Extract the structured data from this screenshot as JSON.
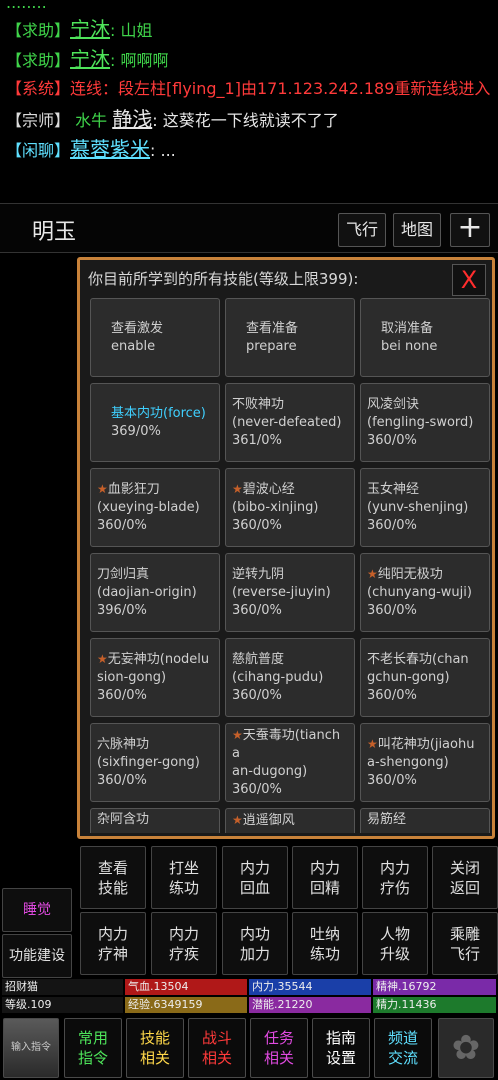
{
  "chat": {
    "partial": "........",
    "lines": [
      {
        "tag": "【求助】",
        "name": "宁沐",
        "msg": ": 山姐"
      },
      {
        "tag": "【求助】",
        "name": "宁沐",
        "msg": ": 啊啊啊"
      },
      {
        "tag": "【系统】",
        "text": "连线：段左柱[flying_1]由171.123.242.189重新连线进入"
      },
      {
        "tag": "【宗师】",
        "prefix": "水牛",
        "name": "静浅",
        "msg": ": 这葵花一下线就读不了了"
      },
      {
        "tag": "【闲聊】",
        "name": "慕蓉紫米",
        "msg": ": ..."
      }
    ]
  },
  "location": {
    "name": "明玉",
    "fly": "飞行",
    "map": "地图",
    "plus": "+"
  },
  "dialog": {
    "title": "你目前所学到的所有技能(等级上限399):",
    "close": "X",
    "skills": [
      {
        "l1": "查看激发",
        "l2": "enable",
        "l3": ""
      },
      {
        "l1": "查看准备",
        "l2": "prepare",
        "l3": ""
      },
      {
        "l1": "取消准备",
        "l2": "bei none",
        "l3": ""
      },
      {
        "l1": "基本内功(force)",
        "l2": "369/0%",
        "l3": "",
        "highlight": true
      },
      {
        "l1": "不败神功",
        "l2": "(never-defeated)",
        "l3": "361/0%"
      },
      {
        "l1": "风凌剑诀",
        "l2": "(fengling-sword)",
        "l3": "360/0%"
      },
      {
        "mark": "★",
        "l1": "血影狂刀",
        "l2": "(xueying-blade)",
        "l3": "360/0%"
      },
      {
        "mark": "★",
        "l1": "碧波心经",
        "l2": "(bibo-xinjing)",
        "l3": "360/0%"
      },
      {
        "l1": "玉女神经",
        "l2": "(yunv-shenjing)",
        "l3": "360/0%"
      },
      {
        "l1": "刀剑归真",
        "l2": "(daojian-origin)",
        "l3": "396/0%"
      },
      {
        "l1": "逆转九阴",
        "l2": "(reverse-jiuyin)",
        "l3": "360/0%"
      },
      {
        "mark": "★",
        "l1": "纯阳无极功",
        "l2": "(chunyang-wuji)",
        "l3": "360/0%"
      },
      {
        "mark": "★",
        "l1": "无妄神功(nodelu",
        "l2": "sion-gong)",
        "l3": "360/0%"
      },
      {
        "l1": "慈航普度",
        "l2": "(cihang-pudu)",
        "l3": "360/0%"
      },
      {
        "l1": "不老长春功(chan",
        "l2": "gchun-gong)",
        "l3": "360/0%"
      },
      {
        "l1": "六脉神功",
        "l2": "(sixfinger-gong)",
        "l3": "360/0%"
      },
      {
        "mark": "★",
        "l1": "天蚕毒功(tiancha",
        "l2": "an-dugong)",
        "l3": "360/0%"
      },
      {
        "mark": "★",
        "l1": "叫花神功(jiaohu",
        "l2": "a-shengong)",
        "l3": "360/0%"
      },
      {
        "l1": "杂阿含功",
        "l2": "",
        "l3": ""
      },
      {
        "mark": "★",
        "l1": "逍遥御风",
        "l2": "",
        "l3": ""
      },
      {
        "l1": "易筋经",
        "l2": "",
        "l3": ""
      }
    ]
  },
  "side": {
    "sleep": "睡觉",
    "build": "功能建设"
  },
  "actions": [
    {
      "l1": "查看",
      "l2": "技能"
    },
    {
      "l1": "打坐",
      "l2": "练功"
    },
    {
      "l1": "内力",
      "l2": "回血"
    },
    {
      "l1": "内力",
      "l2": "回精"
    },
    {
      "l1": "内力",
      "l2": "疗伤"
    },
    {
      "l1": "关闭",
      "l2": "返回"
    },
    {
      "l1": "内力",
      "l2": "疗神"
    },
    {
      "l1": "内力",
      "l2": "疗疾"
    },
    {
      "l1": "内功",
      "l2": "加力"
    },
    {
      "l1": "吐纳",
      "l2": "练功"
    },
    {
      "l1": "人物",
      "l2": "升级"
    },
    {
      "l1": "乘雕",
      "l2": "飞行"
    }
  ],
  "stats": {
    "name": "招财猫",
    "qixue": "气血.13504",
    "neili": "内力.35544",
    "jingshen": "精神.16792",
    "level": "等级.109",
    "exp": "经验.6349159",
    "qianneng": "潜能.21220",
    "jingli": "精力.11436",
    "colors": {
      "qixue": "#b01818",
      "neili": "#1a3fa8",
      "jingshen": "#7a2aa8",
      "exp": "#8a6a18",
      "qianneng": "#8a2aa0",
      "jingli": "#1d7a2c"
    }
  },
  "nav": {
    "input": "输入指令",
    "items": [
      {
        "l1": "常用",
        "l2": "指令",
        "color": "#4ee45a"
      },
      {
        "l1": "技能",
        "l2": "相关",
        "color": "#ffd84a"
      },
      {
        "l1": "战斗",
        "l2": "相关",
        "color": "#ff3a3a"
      },
      {
        "l1": "任务",
        "l2": "相关",
        "color": "#e04ae0"
      },
      {
        "l1": "指南",
        "l2": "设置",
        "color": "#ffffff"
      },
      {
        "l1": "频道",
        "l2": "交流",
        "color": "#5fe0ff"
      }
    ],
    "gear": "✿"
  }
}
